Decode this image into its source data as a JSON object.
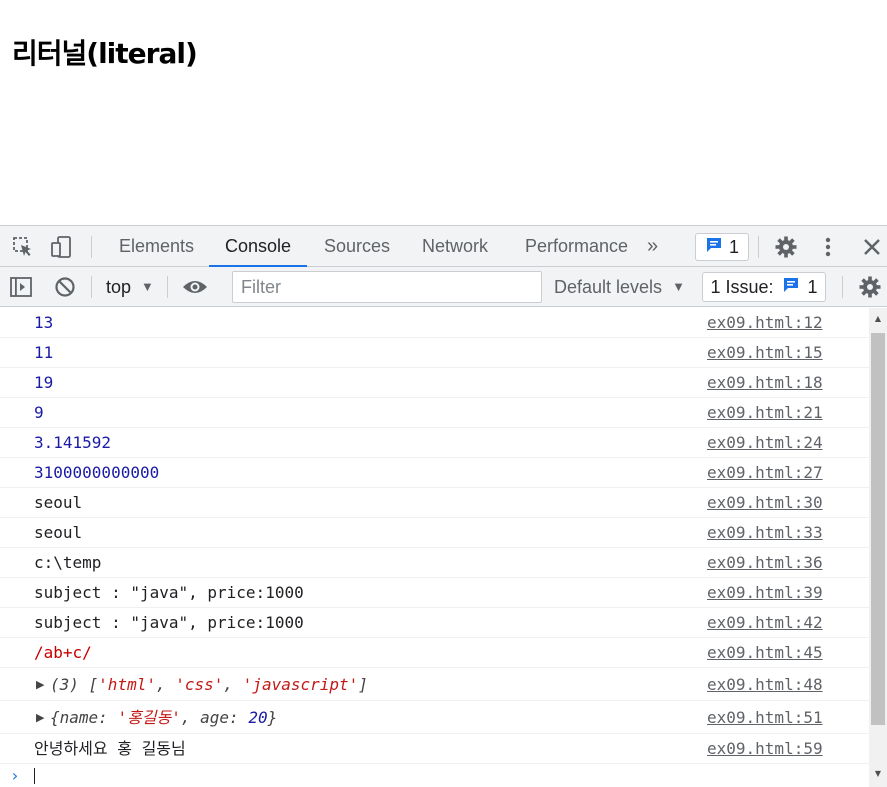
{
  "page": {
    "heading": "리터널(literal)"
  },
  "devtools": {
    "tabs": [
      {
        "label": "Elements"
      },
      {
        "label": "Console"
      },
      {
        "label": "Sources"
      },
      {
        "label": "Network"
      },
      {
        "label": "Performance"
      }
    ],
    "more_tabs": "»",
    "message_count": "1",
    "toolbar": {
      "context": "top",
      "filter_placeholder": "Filter",
      "levels": "Default levels",
      "issues_label": "1 Issue:",
      "issues_count": "1"
    },
    "colors": {
      "accent": "#1a73e8",
      "number": "#1a1aa6",
      "string": "#c41a16",
      "regex": "#c80000"
    },
    "logs": [
      {
        "text": "13",
        "source": "ex09.html:12"
      },
      {
        "text": "11",
        "source": "ex09.html:15"
      },
      {
        "text": "19",
        "source": "ex09.html:18"
      },
      {
        "text": "9",
        "source": "ex09.html:21"
      },
      {
        "text": "3.141592",
        "source": "ex09.html:24"
      },
      {
        "text": "3100000000000",
        "source": "ex09.html:27"
      },
      {
        "text": "seoul",
        "source": "ex09.html:30"
      },
      {
        "text": "seoul",
        "source": "ex09.html:33"
      },
      {
        "text": "c:\\temp",
        "source": "ex09.html:36"
      },
      {
        "text": "subject : \"java\", price:1000",
        "source": "ex09.html:39"
      },
      {
        "text": "subject : \"java\", price:1000",
        "source": "ex09.html:42"
      },
      {
        "text": "/ab+c/",
        "source": "ex09.html:45"
      },
      {
        "array_prefix": "(3) [",
        "items": [
          "'html'",
          "'css'",
          "'javascript'"
        ],
        "array_suffix": "]",
        "source": "ex09.html:48"
      },
      {
        "obj_open": "{name: ",
        "name_value": "'홍길동'",
        "age_key": ", age: ",
        "age_value": "20",
        "obj_close": "}",
        "source": "ex09.html:51"
      },
      {
        "text": "안녕하세요 홍 길동님",
        "source": "ex09.html:59"
      }
    ],
    "prompt": "›"
  }
}
